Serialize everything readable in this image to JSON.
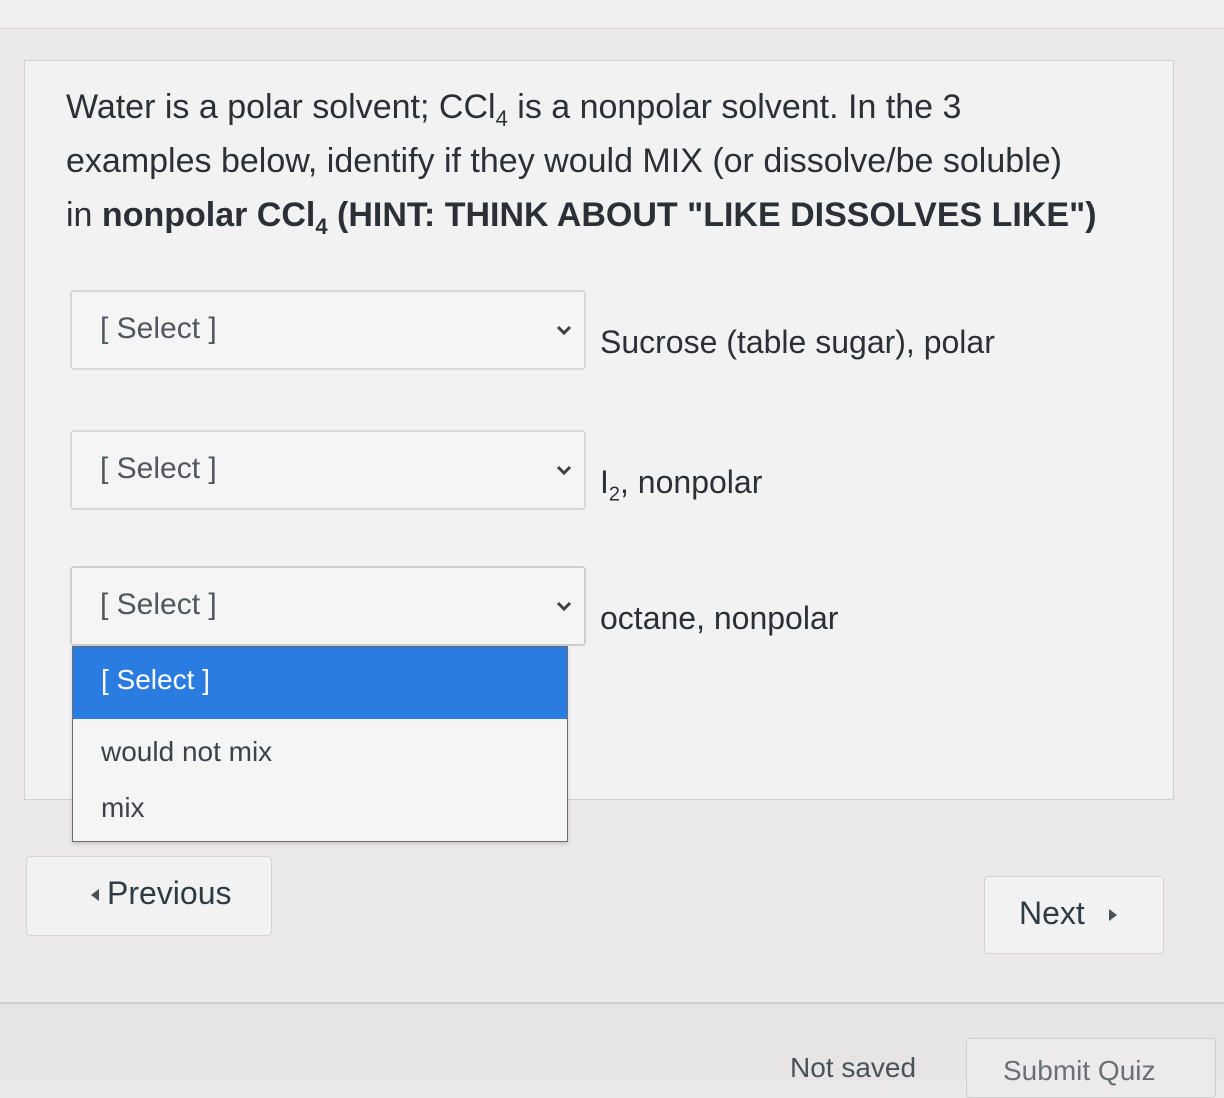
{
  "question": {
    "line1_before": "Water is a polar solvent; CCl",
    "sub1": "4",
    "line1_after": " is a nonpolar solvent. In the 3",
    "line2": "examples below, identify if they would MIX (or dissolve/be soluble)",
    "line3_before": "in ",
    "line3_bold_before": "nonpolar CCl",
    "sub2": "4",
    "line3_bold_after": " (HINT: THINK ABOUT \"LIKE DISSOLVES LIKE\")"
  },
  "rows": [
    {
      "select_value": "[ Select ]",
      "label": "Sucrose (table sugar), polar"
    },
    {
      "select_value": "[ Select ]",
      "label_main": "I",
      "label_sub": "2",
      "label_after": ", nonpolar"
    },
    {
      "select_value": "[ Select ]",
      "label": "octane, nonpolar"
    }
  ],
  "dropdown": {
    "options": [
      "[ Select ]",
      "would not mix",
      "mix"
    ],
    "highlighted_index": 0,
    "highlight_color": "#2b7ce0"
  },
  "navigation": {
    "previous_label": "Previous",
    "next_label": "Next"
  },
  "footer": {
    "status": "Not saved",
    "submit_label": "Submit Quiz"
  }
}
